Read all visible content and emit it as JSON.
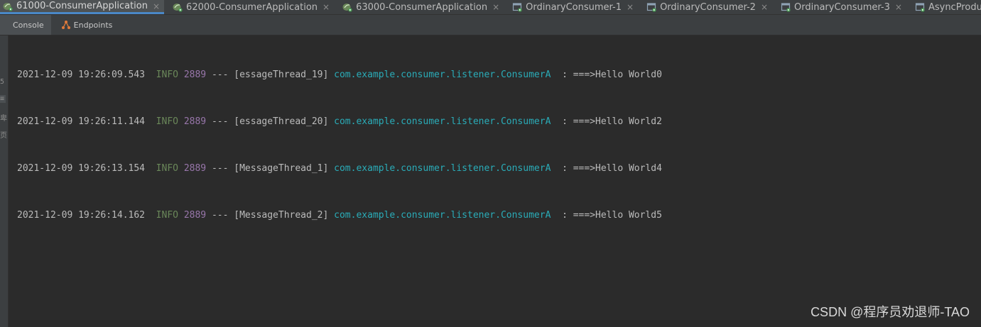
{
  "run_tabs": [
    {
      "label": "61000-ConsumerApplication",
      "icon": "spring-app-icon",
      "active": true
    },
    {
      "label": "62000-ConsumerApplication",
      "icon": "spring-app-icon",
      "active": false
    },
    {
      "label": "63000-ConsumerApplication",
      "icon": "spring-app-icon",
      "active": false
    },
    {
      "label": "OrdinaryConsumer-1",
      "icon": "application-icon",
      "active": false
    },
    {
      "label": "OrdinaryConsumer-2",
      "icon": "application-icon",
      "active": false
    },
    {
      "label": "OrdinaryConsumer-3",
      "icon": "application-icon",
      "active": false
    },
    {
      "label": "AsyncProducer",
      "icon": "application-icon",
      "active": false
    }
  ],
  "close_glyph": "×",
  "sub_tabs": {
    "console_label": "Console",
    "endpoints_label": "Endpoints"
  },
  "gutter_marks": [
    "5",
    "≡",
    "卑",
    "页"
  ],
  "log_lines": [
    {
      "timestamp": "2021-12-09 19:26:09.543",
      "level": "INFO",
      "pid": "2889",
      "sep": "---",
      "thread": "[essageThread_19]",
      "logger": "com.example.consumer.listener.ConsumerA",
      "message": ": ===>Hello World0"
    },
    {
      "timestamp": "2021-12-09 19:26:11.144",
      "level": "INFO",
      "pid": "2889",
      "sep": "---",
      "thread": "[essageThread_20]",
      "logger": "com.example.consumer.listener.ConsumerA",
      "message": ": ===>Hello World2"
    },
    {
      "timestamp": "2021-12-09 19:26:13.154",
      "level": "INFO",
      "pid": "2889",
      "sep": "---",
      "thread": "[MessageThread_1]",
      "logger": "com.example.consumer.listener.ConsumerA",
      "message": ": ===>Hello World4"
    },
    {
      "timestamp": "2021-12-09 19:26:14.162",
      "level": "INFO",
      "pid": "2889",
      "sep": "---",
      "thread": "[MessageThread_2]",
      "logger": "com.example.consumer.listener.ConsumerA",
      "message": ": ===>Hello World5"
    }
  ],
  "watermark": "CSDN @程序员劝退师-TAO",
  "colors": {
    "level": "#6a8759",
    "pid": "#9876aa",
    "logger": "#2aacb8",
    "active_tab_underline": "#4a88c7"
  }
}
